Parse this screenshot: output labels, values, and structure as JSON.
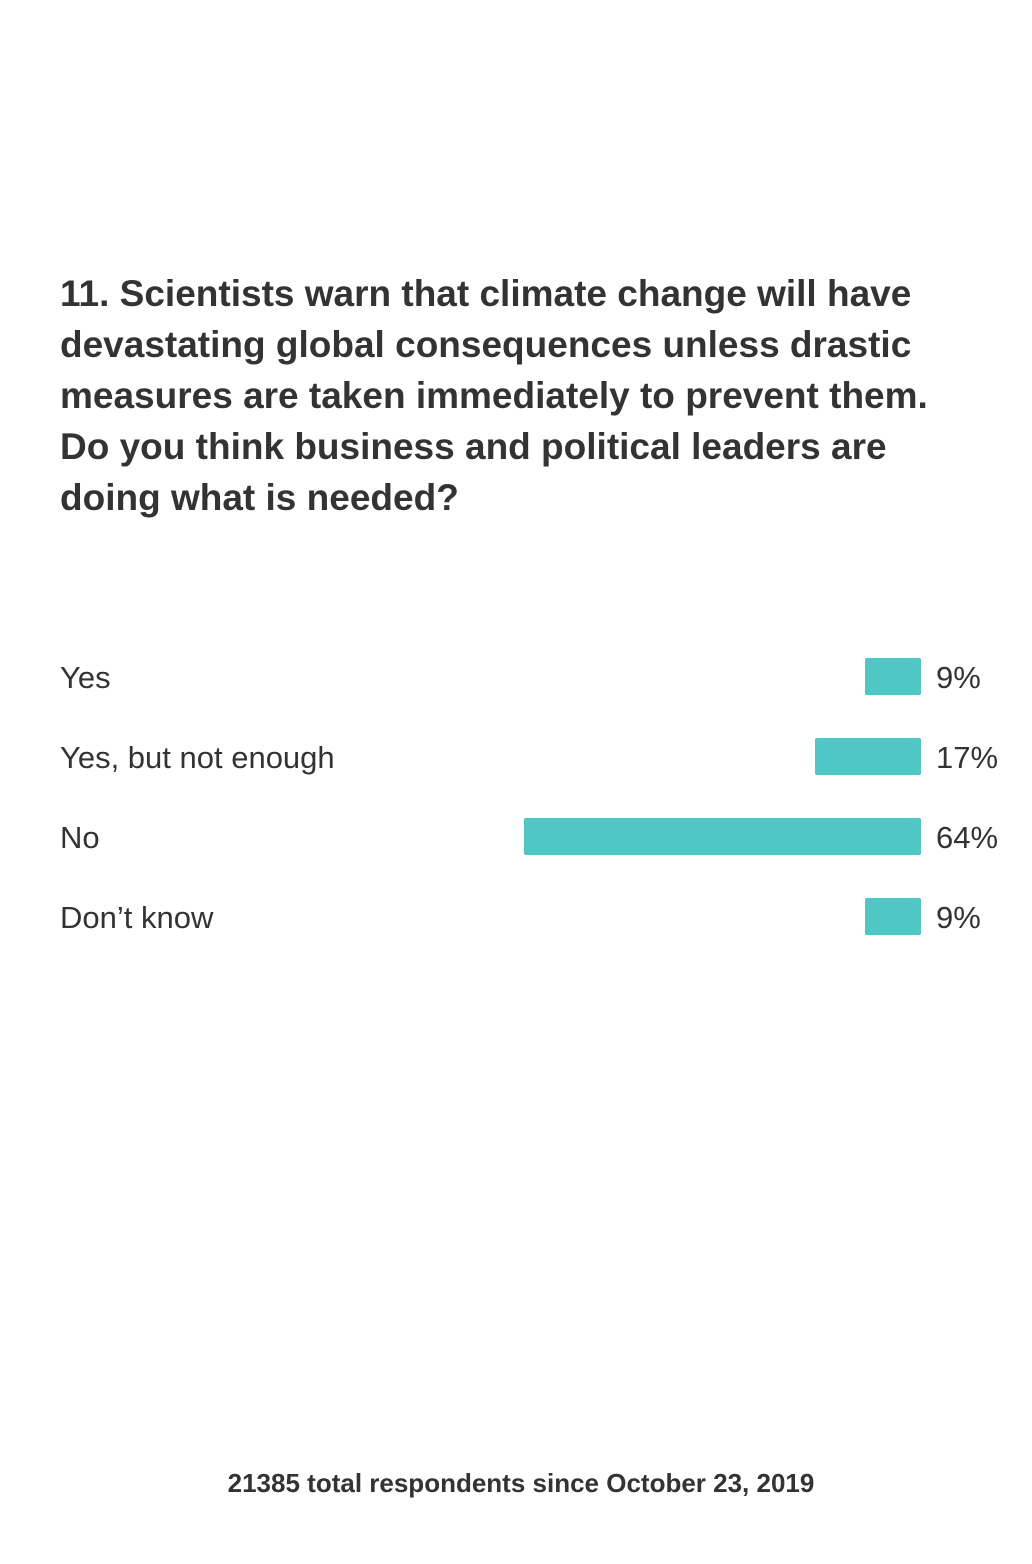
{
  "question": {
    "text": "11. Scientists warn that climate change will have devastating global consequences unless drastic measures are taken immediately to prevent them. Do you think business and political leaders are doing what is needed?"
  },
  "chart_data": {
    "type": "bar",
    "orientation": "horizontal",
    "categories": [
      "Yes",
      "Yes, but not enough",
      "No",
      "Don’t know"
    ],
    "values": [
      9,
      17,
      64,
      9
    ],
    "value_labels": [
      "9%",
      "17%",
      "64%",
      "9%"
    ],
    "unit": "%",
    "bar_color": "#4fc7c4",
    "xlim": [
      0,
      100
    ],
    "grid": false
  },
  "footer": {
    "respondents": "21385 total respondents since October 23, 2019"
  }
}
